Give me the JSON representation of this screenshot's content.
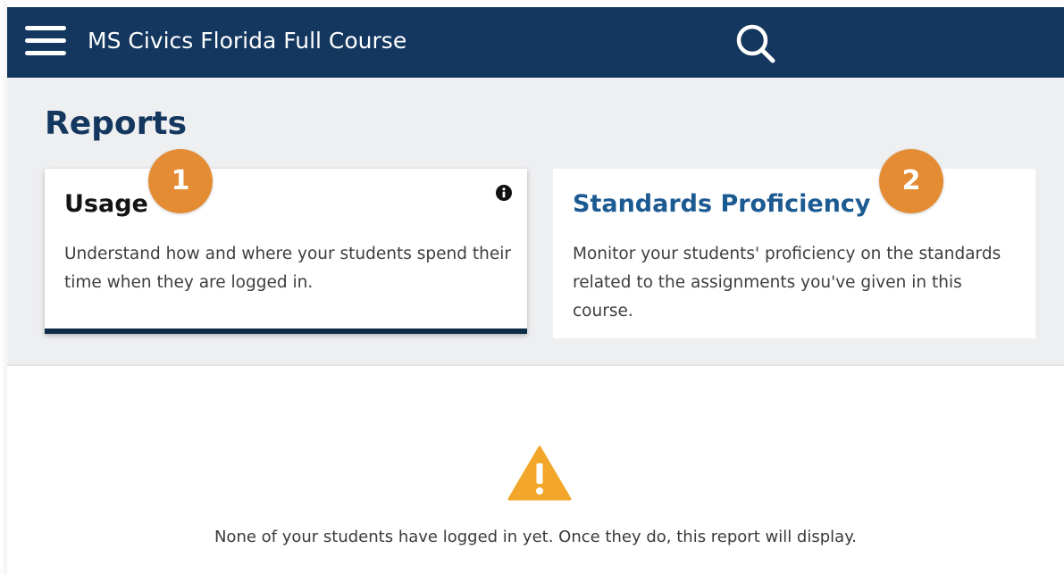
{
  "header": {
    "menu_icon": "hamburger-menu-icon",
    "course_title": "MS Civics Florida Full Course",
    "search_icon": "search-icon",
    "background_color": "#14375f"
  },
  "reports": {
    "title": "Reports",
    "cards": [
      {
        "title": "Usage",
        "description": "Understand how and where your students spend their time when they are logged in.",
        "badge": "1",
        "active": true,
        "info_icon": "info-icon"
      },
      {
        "title": "Standards Proficiency",
        "description": "Monitor your students' proficiency on the standards related to the assignments you've given in this course.",
        "badge": "2",
        "active": false
      }
    ]
  },
  "empty_state": {
    "icon": "warning-icon",
    "message": "None of your students have logged in yet. Once they do, this report will display."
  },
  "colors": {
    "navy": "#14375f",
    "link_blue": "#1c5a92",
    "badge_orange": "#e48c34",
    "warning_yellow": "#f2a72a"
  }
}
